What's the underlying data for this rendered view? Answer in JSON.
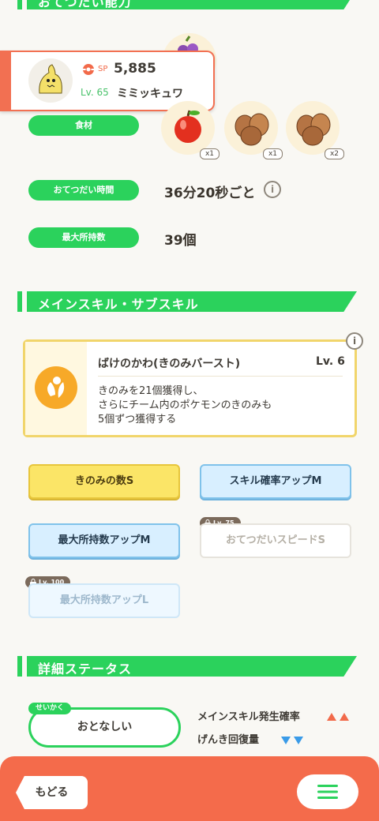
{
  "sections": {
    "help_ability": "おてつだい能力",
    "skills": "メインスキル・サブスキル",
    "details": "詳細ステータス"
  },
  "pokemon": {
    "sp_label": "SP",
    "sp_value": "5,885",
    "level": "Lv. 65",
    "name": "ミミッキュワ"
  },
  "ingredients": {
    "label": "食材",
    "items": [
      {
        "name": "apple-icon",
        "count": "x1"
      },
      {
        "name": "nut-icon",
        "count": "x1"
      },
      {
        "name": "nut-icon",
        "count": "x2"
      }
    ]
  },
  "help_time": {
    "label": "おてつだい時間",
    "value": "36分20秒ごと"
  },
  "max_carry": {
    "label": "最大所持数",
    "value": "39個"
  },
  "main_skill": {
    "name": "ばけのかわ(きのみバースト)",
    "level": "Lv. 6",
    "description": [
      "きのみを21個獲得し、",
      "さらにチーム内のポケモンのきのみも",
      "5個ずつ獲得する"
    ]
  },
  "sub_skills": [
    {
      "label": "きのみの数S",
      "style": "gold"
    },
    {
      "label": "スキル確率アップM",
      "style": "blue"
    },
    {
      "label": "最大所持数アップM",
      "style": "blue"
    },
    {
      "label": "おてつだいスピードS",
      "style": "locked",
      "lock": "Lv. 75"
    },
    {
      "label": "最大所持数アップL",
      "style": "locked",
      "lock": "Lv. 100"
    }
  ],
  "nature": {
    "tag": "せいかく",
    "value": "おとなしい",
    "up_label": "メインスキル発生確率",
    "down_label": "げんき回復量",
    "up_color": "#f26a4a",
    "down_color": "#3a9be8"
  },
  "nav": {
    "back": "もどる",
    "menu": "menu-icon"
  },
  "colors": {
    "accent_green": "#2bd25c",
    "bottom_bar": "#f46b4b"
  }
}
